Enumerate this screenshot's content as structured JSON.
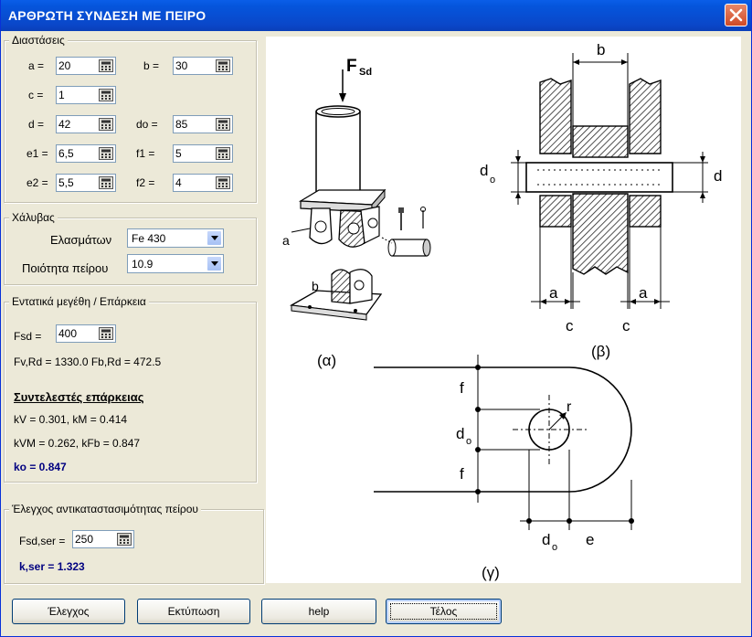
{
  "window": {
    "title": "ΑΡΘΡΩΤΗ ΣΥΝΔΕΣΗ ΜΕ ΠΕΙΡΟ"
  },
  "dimensions": {
    "legend": "Διαστάσεις",
    "fields": [
      {
        "id": "a",
        "label": "a =",
        "value": "20"
      },
      {
        "id": "b",
        "label": "b =",
        "value": "30"
      },
      {
        "id": "c",
        "label": "c =",
        "value": "1"
      },
      {
        "id": "d",
        "label": "d =",
        "value": "42"
      },
      {
        "id": "do",
        "label": "do =",
        "value": "85"
      },
      {
        "id": "e1",
        "label": "e1 =",
        "value": "6,5"
      },
      {
        "id": "f1",
        "label": "f1 =",
        "value": "5"
      },
      {
        "id": "e2",
        "label": "e2 =",
        "value": "5,5"
      },
      {
        "id": "f2",
        "label": "f2 =",
        "value": "4"
      }
    ]
  },
  "steel": {
    "legend": "Χάλυβας",
    "plates_label": "Ελασμάτων",
    "plates_value": "Fe 430",
    "pin_label": "Ποιότητα πείρου",
    "pin_value": "10.9"
  },
  "forces": {
    "legend": "Εντατικά μεγέθη / Επάρκεια",
    "fsd_label": "Fsd =",
    "fsd_value": "400",
    "resistances": "Fv,Rd = 1330.0  Fb,Rd = 472.5",
    "factors_heading": "Συντελεστές επάρκειας",
    "kv_km": "kV = 0.301,  kM = 0.414",
    "kvm_kfb": "kVM = 0.262,  kFb = 0.847",
    "ko": "ko = 0.847"
  },
  "replaceability": {
    "legend": "Έλεγχος αντικαταστασιμότητας πείρου",
    "fsd_ser_label": "Fsd,ser =",
    "fsd_ser_value": "250",
    "k_ser": "k,ser = 1.323"
  },
  "figure": {
    "fsd": "F",
    "fsd_sub": "Sd",
    "cap_a": "(α)",
    "cap_b": "(β)",
    "cap_c": "(γ)",
    "a": "a",
    "b": "b",
    "c": "c",
    "d": "d",
    "d0": "d",
    "d0_sub": "o",
    "f": "f",
    "r": "r",
    "e": "e"
  },
  "buttons": {
    "check": "Έλεγχος",
    "print": "Εκτύπωση",
    "help": "help",
    "end": "Τέλος"
  }
}
